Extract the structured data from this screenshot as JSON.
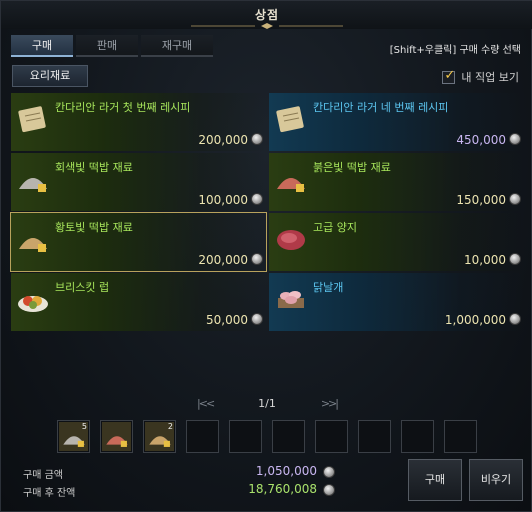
{
  "window": {
    "title": "상점"
  },
  "tabs": [
    {
      "label": "구매",
      "active": true
    },
    {
      "label": "판매",
      "active": false
    },
    {
      "label": "재구매",
      "active": false
    }
  ],
  "hint": "[Shift+우클릭] 구매 수량 선택",
  "category": {
    "label": "요리재료"
  },
  "job_filter": {
    "label": "내 직업 보기",
    "checked": true
  },
  "items": [
    {
      "name": "칸다리안 라거 첫 번째 레시피",
      "price": "200,000",
      "icon": "recipe-scroll-icon",
      "grade": "green"
    },
    {
      "name": "칸다리안 라거 네 번째 레시피",
      "price": "450,000",
      "icon": "recipe-scroll-icon",
      "grade": "blue"
    },
    {
      "name": "회색빛 떡밥 재료",
      "price": "100,000",
      "icon": "gray-bait-icon",
      "grade": "green"
    },
    {
      "name": "붉은빛 떡밥 재료",
      "price": "150,000",
      "icon": "red-bait-icon",
      "grade": "green"
    },
    {
      "name": "황토빛 떡밥 재료",
      "price": "200,000",
      "icon": "ochre-bait-icon",
      "grade": "green",
      "selected": true
    },
    {
      "name": "고급 양지",
      "price": "10,000",
      "icon": "brisket-meat-icon",
      "grade": "green"
    },
    {
      "name": "브리스킷 럽",
      "price": "50,000",
      "icon": "brisket-rub-icon",
      "grade": "green"
    },
    {
      "name": "닭날개",
      "price": "1,000,000",
      "icon": "chicken-wings-icon",
      "grade": "blue"
    }
  ],
  "pager": {
    "first": "|<",
    "prev": "<",
    "page": "1/1",
    "next": ">",
    "last": ">|"
  },
  "cart": [
    {
      "icon": "gray-bait-icon",
      "qty": "5"
    },
    {
      "icon": "red-bait-icon",
      "qty": ""
    },
    {
      "icon": "ochre-bait-icon",
      "qty": "2"
    },
    {
      "icon": "",
      "qty": ""
    },
    {
      "icon": "",
      "qty": ""
    },
    {
      "icon": "",
      "qty": ""
    },
    {
      "icon": "",
      "qty": ""
    },
    {
      "icon": "",
      "qty": ""
    },
    {
      "icon": "",
      "qty": ""
    },
    {
      "icon": "",
      "qty": ""
    }
  ],
  "summary": {
    "total_label": "구매 금액",
    "total_value": "1,050,000",
    "balance_label": "구매 후 잔액",
    "balance_value": "18,760,008"
  },
  "buttons": {
    "buy": "구매",
    "clear": "비우기"
  },
  "colors": {
    "green_name": "#a7e55b",
    "blue_name": "#5cc6f0",
    "selected_border": "#b8a25c"
  }
}
